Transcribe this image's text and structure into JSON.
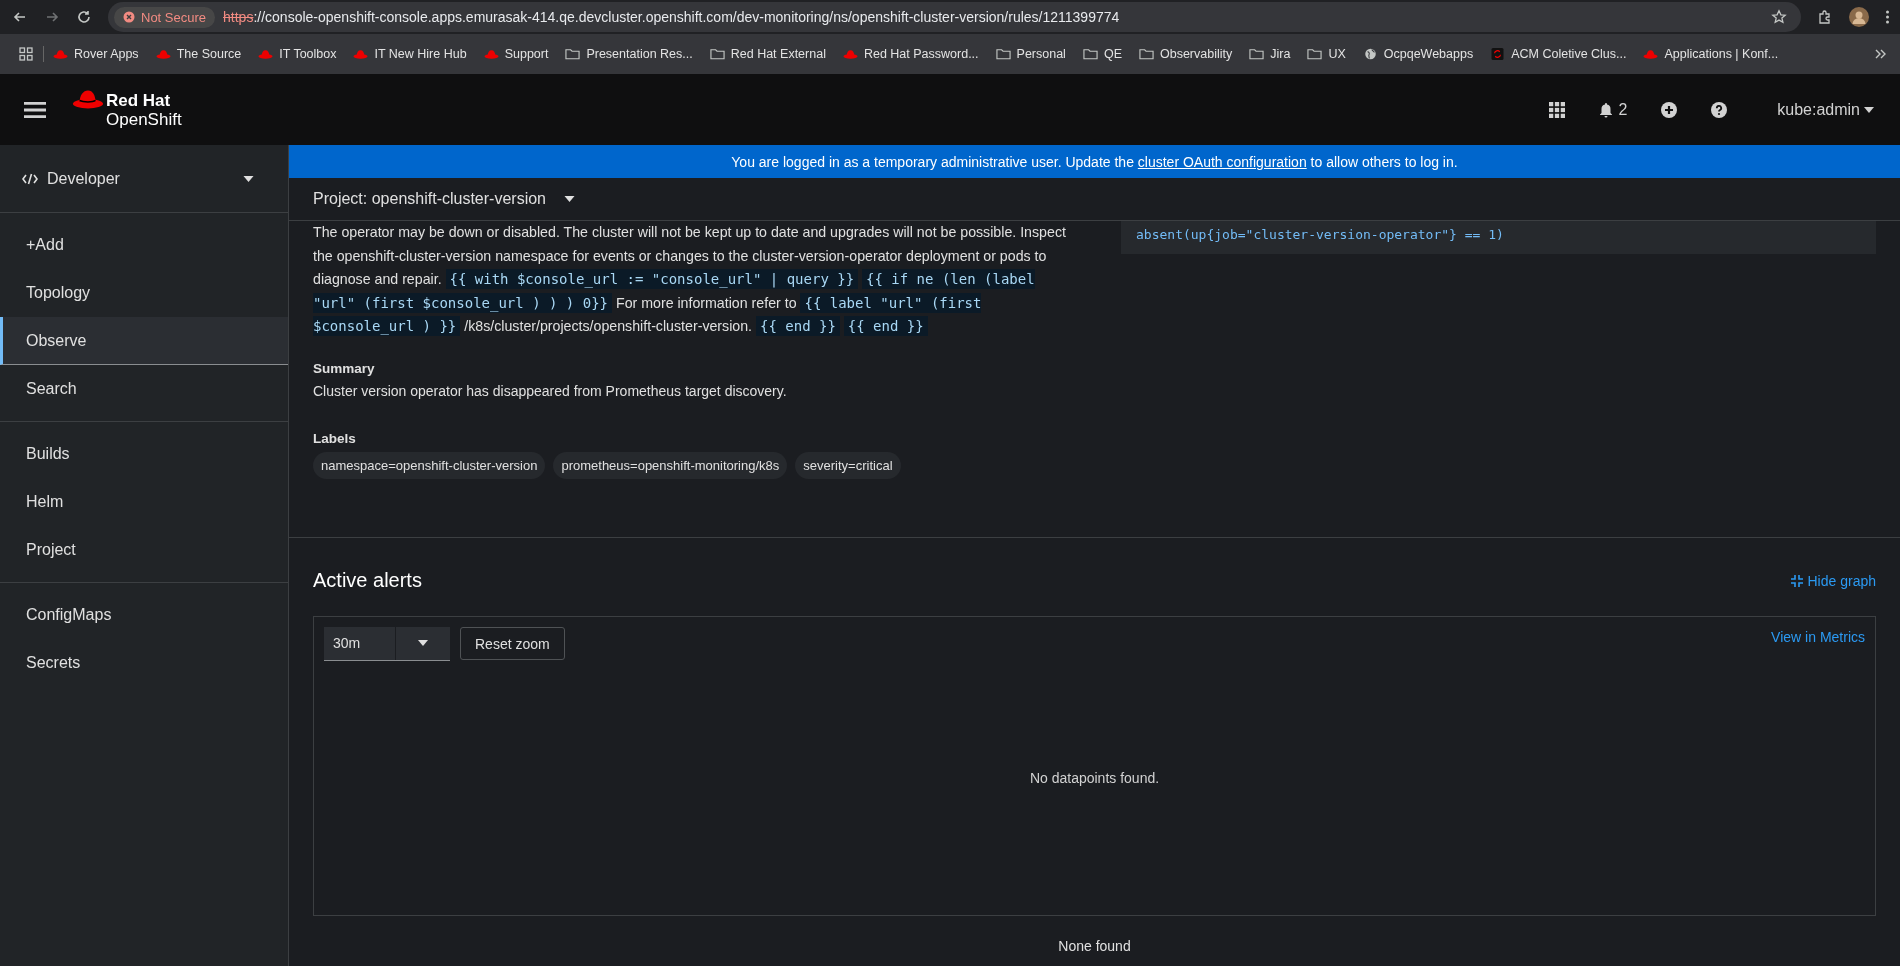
{
  "browser": {
    "security": "Not Secure",
    "url_scheme": "https",
    "url_rest": "://console-openshift-console.apps.emurasak-414.qe.devcluster.openshift.com/dev-monitoring/ns/openshift-cluster-version/rules/1211399774",
    "bookmarks": [
      {
        "kind": "redhat",
        "label": "Rover Apps"
      },
      {
        "kind": "redhat",
        "label": "The Source"
      },
      {
        "kind": "redhat",
        "label": "IT Toolbox"
      },
      {
        "kind": "redhat",
        "label": "IT New Hire Hub"
      },
      {
        "kind": "redhat",
        "label": "Support"
      },
      {
        "kind": "folder",
        "label": "Presentation Res..."
      },
      {
        "kind": "folder",
        "label": "Red Hat External"
      },
      {
        "kind": "redhat",
        "label": "Red Hat Password..."
      },
      {
        "kind": "folder",
        "label": "Personal"
      },
      {
        "kind": "folder",
        "label": "QE"
      },
      {
        "kind": "folder",
        "label": "Observability"
      },
      {
        "kind": "folder",
        "label": "Jira"
      },
      {
        "kind": "folder",
        "label": "UX"
      },
      {
        "kind": "globe",
        "label": "OcpqeWebapps"
      },
      {
        "kind": "acm",
        "label": "ACM Coletive Clus..."
      },
      {
        "kind": "redhat",
        "label": "Applications | Konf..."
      }
    ]
  },
  "masthead": {
    "brand_top": "Red Hat",
    "brand_bottom": "OpenShift",
    "notifications": "2",
    "user": "kube:admin"
  },
  "sidebar": {
    "perspective": "Developer",
    "groups": [
      [
        {
          "label": "+Add",
          "selected": false
        },
        {
          "label": "Topology",
          "selected": false
        },
        {
          "label": "Observe",
          "selected": true
        },
        {
          "label": "Search",
          "selected": false
        }
      ],
      [
        {
          "label": "Builds",
          "selected": false
        },
        {
          "label": "Helm",
          "selected": false
        },
        {
          "label": "Project",
          "selected": false
        }
      ],
      [
        {
          "label": "ConfigMaps",
          "selected": false
        },
        {
          "label": "Secrets",
          "selected": false
        }
      ]
    ]
  },
  "banner": {
    "before": "You are logged in as a temporary administrative user. Update the",
    "link": "cluster OAuth configuration",
    "after": "to allow others to log in."
  },
  "project": "Project: openshift-cluster-version",
  "description": [
    {
      "kind": "text",
      "text": "The operator may be down or disabled. The cluster will not be kept up to date and upgrades will not be possible. Inspect the openshift-cluster-version namespace for events or changes to the cluster-version-operator deployment or pods to diagnose and repair. "
    },
    {
      "kind": "code",
      "text": "{{ with $console_url := \"console_url\" | query }}"
    },
    {
      "kind": "code",
      "text": "{{ if ne (len (label \"url\" (first $console_url ) ) ) 0}}"
    },
    {
      "kind": "text",
      "text": " For more information refer to "
    },
    {
      "kind": "code",
      "text": "{{ label \"url\" (first $console_url ) }}"
    },
    {
      "kind": "text",
      "text": " /k8s/cluster/projects/openshift-cluster-version. "
    },
    {
      "kind": "code",
      "text": "{{ end }}"
    },
    {
      "kind": "code",
      "text": "{{ end }}"
    }
  ],
  "expression": "absent(up{job=\"cluster-version-operator\"} == 1)",
  "summary": {
    "heading": "Summary",
    "text": "Cluster version operator has disappeared from Prometheus target discovery."
  },
  "labels": {
    "heading": "Labels",
    "items": [
      "namespace=openshift-cluster-version",
      "prometheus=openshift-monitoring/k8s",
      "severity=critical"
    ]
  },
  "active_alerts": {
    "title": "Active alerts",
    "hide_graph": "Hide graph",
    "timespan": "30m",
    "reset_zoom": "Reset zoom",
    "view_metrics": "View in Metrics",
    "empty_graph": "No datapoints found.",
    "empty_table": "None found"
  }
}
